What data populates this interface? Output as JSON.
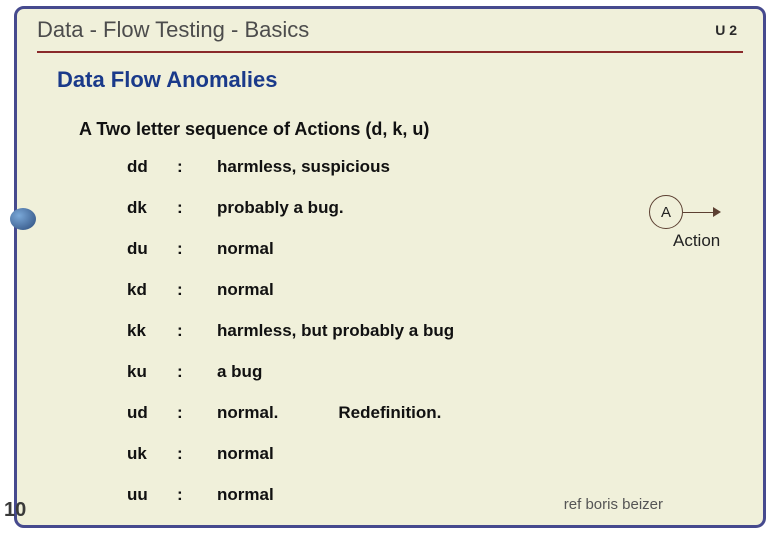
{
  "header": {
    "title": "Data - Flow Testing   -  Basics",
    "tag": "U 2"
  },
  "subtitle": "Data Flow Anomalies",
  "intro": "A Two letter sequence of Actions   (d, k, u)",
  "rows": [
    {
      "code": "dd",
      "colon": ":",
      "desc": "harmless, suspicious",
      "extra": ""
    },
    {
      "code": "dk",
      "colon": ":",
      "desc": "probably a bug.",
      "extra": ""
    },
    {
      "code": "du",
      "colon": ":",
      "desc": "normal",
      "extra": ""
    },
    {
      "code": "kd",
      "colon": ":",
      "desc": "normal",
      "extra": ""
    },
    {
      "code": "kk",
      "colon": ":",
      "desc": "harmless, but probably a bug",
      "extra": ""
    },
    {
      "code": "ku",
      "colon": ":",
      "desc": "a bug",
      "extra": ""
    },
    {
      "code": "ud",
      "colon": ":",
      "desc": "normal.",
      "extra": "Redefinition."
    },
    {
      "code": "uk",
      "colon": ":",
      "desc": "normal",
      "extra": ""
    },
    {
      "code": "uu",
      "colon": ":",
      "desc": "normal",
      "extra": ""
    }
  ],
  "diagram": {
    "node": "A",
    "label": "Action"
  },
  "ref": "ref boris beizer",
  "pagenum": "10"
}
